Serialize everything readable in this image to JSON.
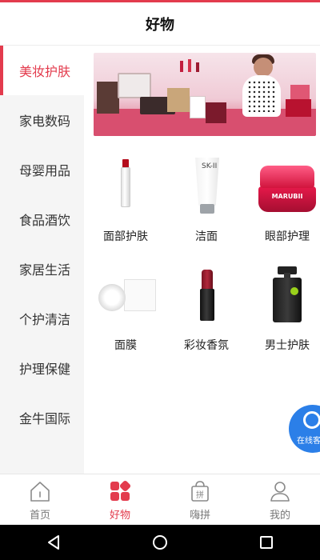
{
  "header": {
    "title": "好物"
  },
  "sidebar": {
    "items": [
      {
        "label": "美妆护肤",
        "active": true
      },
      {
        "label": "家电数码"
      },
      {
        "label": "母婴用品"
      },
      {
        "label": "食品酒饮"
      },
      {
        "label": "家居生活"
      },
      {
        "label": "个护清洁"
      },
      {
        "label": "护理保健"
      },
      {
        "label": "金牛国际"
      }
    ]
  },
  "categories": [
    {
      "label": "面部护肤",
      "icon": "essence-bottle-icon"
    },
    {
      "label": "洁面",
      "icon": "cleanser-tube-icon"
    },
    {
      "label": "眼部护理",
      "icon": "eye-cream-jar-icon"
    },
    {
      "label": "面膜",
      "icon": "face-mask-icon"
    },
    {
      "label": "彩妆香氛",
      "icon": "lipstick-icon"
    },
    {
      "label": "男士护肤",
      "icon": "pump-bottle-icon"
    }
  ],
  "product_text": {
    "tube": "SK-II",
    "jar": "MARUBII"
  },
  "chat": {
    "label": "在线客"
  },
  "tabbar": {
    "items": [
      {
        "label": "首页",
        "icon": "home-icon"
      },
      {
        "label": "好物",
        "icon": "grid-icon",
        "active": true
      },
      {
        "label": "嗨拼",
        "icon": "group-buy-bag-icon",
        "badge": "拼"
      },
      {
        "label": "我的",
        "icon": "profile-icon"
      }
    ]
  },
  "colors": {
    "accent": "#e33b4d",
    "chat": "#2b7fe8"
  }
}
